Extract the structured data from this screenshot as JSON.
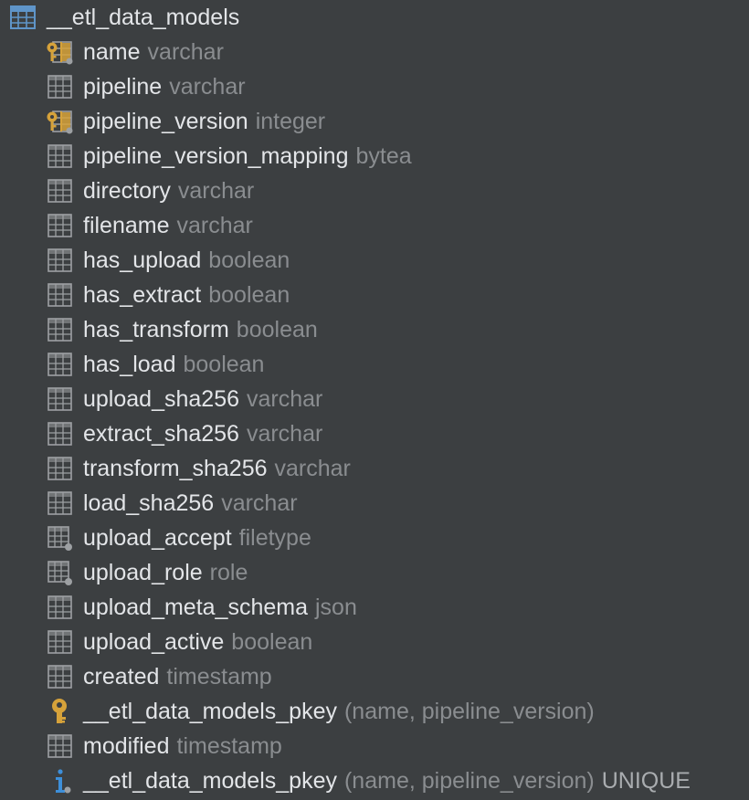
{
  "table": {
    "name": "__etl_data_models",
    "icon": "table-icon"
  },
  "columns": [
    {
      "name": "name",
      "type": "varchar",
      "icon": "primary-key-column-icon"
    },
    {
      "name": "pipeline",
      "type": "varchar",
      "icon": "column-icon"
    },
    {
      "name": "pipeline_version",
      "type": "integer",
      "icon": "primary-key-column-icon"
    },
    {
      "name": "pipeline_version_mapping",
      "type": "bytea",
      "icon": "column-icon"
    },
    {
      "name": "directory",
      "type": "varchar",
      "icon": "column-icon"
    },
    {
      "name": "filename",
      "type": "varchar",
      "icon": "column-icon"
    },
    {
      "name": "has_upload",
      "type": "boolean",
      "icon": "column-icon"
    },
    {
      "name": "has_extract",
      "type": "boolean",
      "icon": "column-icon"
    },
    {
      "name": "has_transform",
      "type": "boolean",
      "icon": "column-icon"
    },
    {
      "name": "has_load",
      "type": "boolean",
      "icon": "column-icon"
    },
    {
      "name": "upload_sha256",
      "type": "varchar",
      "icon": "column-icon"
    },
    {
      "name": "extract_sha256",
      "type": "varchar",
      "icon": "column-icon"
    },
    {
      "name": "transform_sha256",
      "type": "varchar",
      "icon": "column-icon"
    },
    {
      "name": "load_sha256",
      "type": "varchar",
      "icon": "column-icon"
    },
    {
      "name": "upload_accept",
      "type": "filetype",
      "icon": "nullable-column-icon"
    },
    {
      "name": "upload_role",
      "type": "role",
      "icon": "nullable-column-icon"
    },
    {
      "name": "upload_meta_schema",
      "type": "json",
      "icon": "column-icon"
    },
    {
      "name": "upload_active",
      "type": "boolean",
      "icon": "column-icon"
    },
    {
      "name": "created",
      "type": "timestamp",
      "icon": "column-icon"
    }
  ],
  "key": {
    "name": "__etl_data_models_pkey",
    "detail": "(name, pipeline_version)",
    "icon": "key-icon"
  },
  "column_after_key": {
    "name": "modified",
    "type": "timestamp",
    "icon": "column-icon"
  },
  "index": {
    "name": "__etl_data_models_pkey",
    "detail": "(name, pipeline_version)",
    "unique": "UNIQUE",
    "icon": "index-info-icon"
  },
  "colors": {
    "background": "#3c3f41",
    "name_text": "#e3e5e8",
    "type_text": "#8a8d90",
    "table_icon": "#5f95c9",
    "column_icon": "#9da0a3",
    "key_gold": "#d6a23a",
    "info_blue": "#3d8fd9"
  }
}
